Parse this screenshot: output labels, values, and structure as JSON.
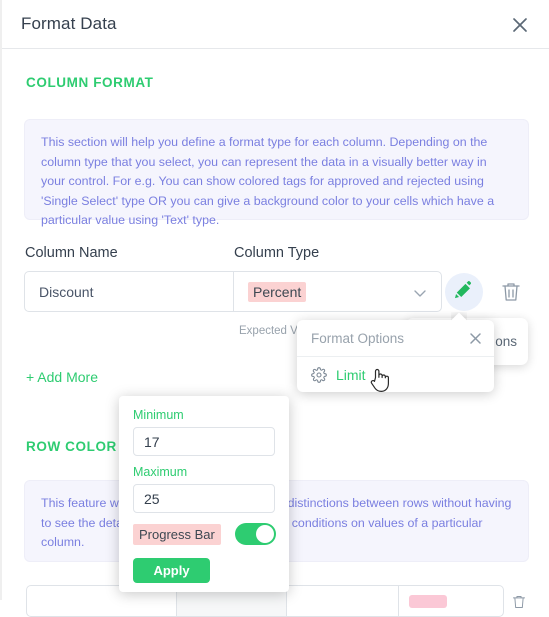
{
  "header": {
    "title": "Format Data",
    "close_icon": "close-icon"
  },
  "column_format": {
    "section_title": "COLUMN FORMAT",
    "info_text": "This section will help you define a format type for each column. Depending on the column type that you select, you can represent the data in a visually better way in your control. For e.g. You can show colored tags for approved and rejected using 'Single Select' type OR you can give a background color to your cells which have a particular value using 'Text' type.",
    "labels": {
      "column_name": "Column Name",
      "column_type": "Column Type"
    },
    "row": {
      "name_value": "Discount",
      "type_value": "Percent",
      "chevron_icon": "chevron-down-icon",
      "brush_icon": "paint-brush-icon",
      "trash_icon": "trash-icon"
    },
    "expected_hint": "Expected V",
    "ghost_card_text": "ons",
    "add_more_label": "+ Add More"
  },
  "format_options_popover": {
    "title": "Format Options",
    "close_icon": "close-icon",
    "items": [
      {
        "label": "Limit",
        "icon": "gear-icon"
      }
    ]
  },
  "limit_panel": {
    "minimum_label": "Minimum",
    "minimum_value": "17",
    "maximum_label": "Maximum",
    "maximum_value": "25",
    "progress_bar_label": "Progress Bar",
    "progress_bar_on": "on",
    "apply_label": "Apply"
  },
  "row_color": {
    "section_title": "ROW COLOR",
    "info_text": "This feature will help you identify meaningful distinctions between rows without having to see the details. You can apply colors using conditions on values of a particular column."
  },
  "colors": {
    "accent_green": "#2ecc71",
    "info_text_purple": "#7a7fe0",
    "info_bg": "#f5f5fd",
    "highlight_pink": "#fbd2d2",
    "title_dark": "#35404e"
  }
}
